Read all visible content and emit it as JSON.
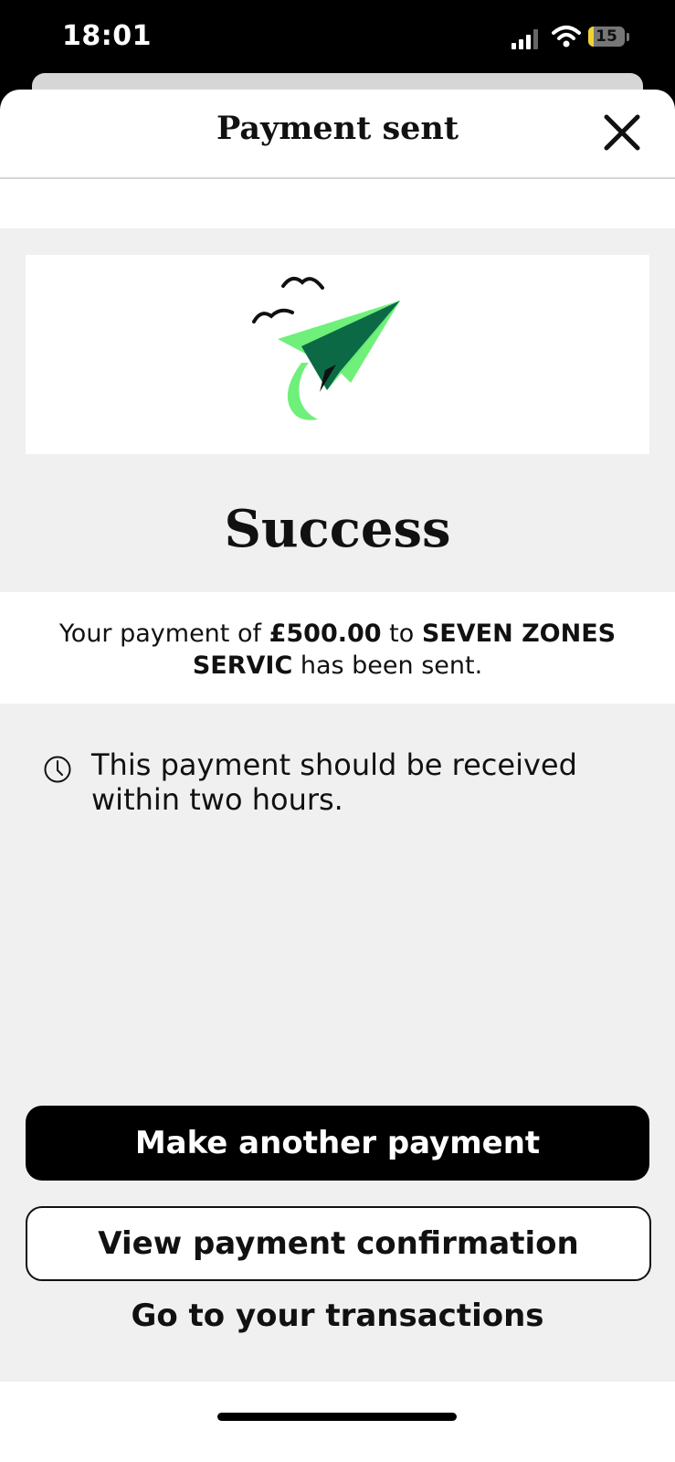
{
  "status_bar": {
    "time": "18:01",
    "battery_level": "15",
    "battery_fraction": 0.15
  },
  "header": {
    "title": "Payment sent"
  },
  "result": {
    "title": "Success"
  },
  "message": {
    "prefix": "Your payment of ",
    "amount": "£500.00",
    "middle": " to ",
    "recipient": "SEVEN ZONES SERVIC",
    "suffix": " has been sent."
  },
  "info": {
    "text": "This payment should be received within two hours."
  },
  "actions": {
    "primary_label": "Make another payment",
    "secondary_label": "View payment confirmation",
    "link_label": "Go to your transactions"
  },
  "colors": {
    "accent_green": "#6ff07a",
    "dark_green": "#0b6a45"
  },
  "icons": {
    "close": "close-icon",
    "clock": "clock-icon",
    "illustration": "paper-plane-with-birds-illustration"
  }
}
